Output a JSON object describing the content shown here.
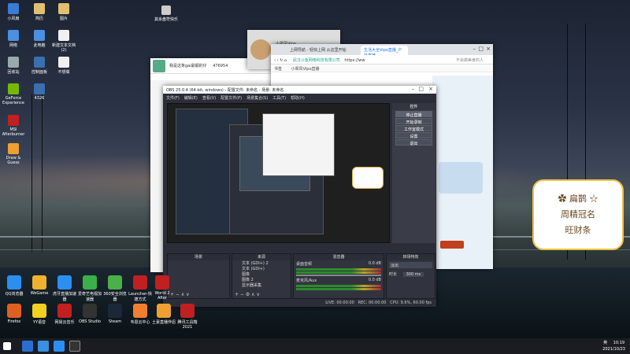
{
  "desktop": {
    "icons": [
      {
        "label": "小风扇",
        "color": "#3a7bd5"
      },
      {
        "label": "简历",
        "color": "#e0c070"
      },
      {
        "label": "图片",
        "color": "#e0c070"
      },
      {
        "label": "网络",
        "color": "#4a8fe0"
      },
      {
        "label": "此电脑",
        "color": "#4a8fe0"
      },
      {
        "label": "新建文本文档 (2)",
        "color": "#f0f0f0"
      },
      {
        "label": "回收站",
        "color": "#9aa"
      },
      {
        "label": "控制面板",
        "color": "#3a6fb0"
      },
      {
        "label": "不想做",
        "color": "#f0f0f0"
      },
      {
        "label": "GeForce Experience",
        "color": "#76b900"
      },
      {
        "label": "4326",
        "color": "#3a6fb0"
      },
      {
        "label": "MSI Afterburner",
        "color": "#c02020"
      },
      {
        "label": "Draw & Guess",
        "color": "#f0a030"
      }
    ],
    "notification_icon_label": "其余盘符快乐",
    "dock_icons": [
      {
        "label": "QQ浏览器",
        "color": "#2a8ff0"
      },
      {
        "label": "WeGame",
        "color": "#f0b030"
      },
      {
        "label": "虎牙直播加速器",
        "color": "#2a8ff0"
      },
      {
        "label": "爱奇艺电视加速器",
        "color": "#3ab04a"
      },
      {
        "label": "360安全浏览器",
        "color": "#4ab04a"
      },
      {
        "label": "Launcher-快捷方式",
        "color": "#c02020"
      },
      {
        "label": "World 2 After",
        "color": "#c02020"
      },
      {
        "label": "Firefox",
        "color": "#e06020"
      },
      {
        "label": "YY语音",
        "color": "#f0d020"
      },
      {
        "label": "网易云音乐",
        "color": "#c02020"
      },
      {
        "label": "OBS Studio",
        "color": "#333"
      },
      {
        "label": "Steam",
        "color": "#1b2838"
      },
      {
        "label": "韦恩云中心",
        "color": "#f08030"
      },
      {
        "label": "土豪直播伴侣",
        "color": "#f0a030"
      },
      {
        "label": "腾讯工具箱2021",
        "color": "#c02020"
      }
    ],
    "sticker": {
      "line1": "✿ 扁鹊 ☆",
      "line2": "周精冠名",
      "line3": "旺财条"
    }
  },
  "qq_window": {
    "title": "我是这条gai最靓的仔",
    "count": "476954",
    "avatar_label": "小翠风Vipo"
  },
  "browser": {
    "tab1": "上网导航 - 轻快上网 从这里开始",
    "tab2": "生活大全Vipo直播_户外直播",
    "address_site": "武汉斗鱼网络科技有限公司",
    "address_url": "https://ww",
    "search_hint": "不会做美食的人",
    "bookmark1": "书签",
    "bookmark2": "小翠风Vipo直播"
  },
  "obs": {
    "title": "OBS 25.0.4 (64-bit, windows) - 配置文件: 未命名 - 场景: 未命名",
    "menu": [
      "文件(F)",
      "编辑(E)",
      "查看(V)",
      "配置文件(P)",
      "场景集合(S)",
      "工具(T)",
      "帮助(H)"
    ],
    "controls_title": "控件",
    "controls": [
      "停止直播",
      "开始录制",
      "工作室模式",
      "设置",
      "退出"
    ],
    "scenes_title": "场景",
    "sources_title": "来源",
    "sources": [
      "文本 (GDI+) 2",
      "文本 (GDI+)",
      "图像",
      "图像 2",
      "显示器采集"
    ],
    "mixer_title": "混音器",
    "mixer": [
      {
        "name": "桌面音频",
        "level": "0.0 dB"
      },
      {
        "name": "麦克风/Aux",
        "level": "0.0 dB"
      }
    ],
    "transitions_title": "转场特效",
    "transition": "淡出",
    "duration_label": "时长",
    "duration": "300 ms",
    "status": {
      "live": "LIVE: 00:00:00",
      "rec": "REC: 00:00:00",
      "cpu": "CPU: 9.6%, 60.00 fps"
    }
  },
  "taskbar": {
    "time": "10:19",
    "date": "2021/10/23",
    "ime": "英"
  }
}
